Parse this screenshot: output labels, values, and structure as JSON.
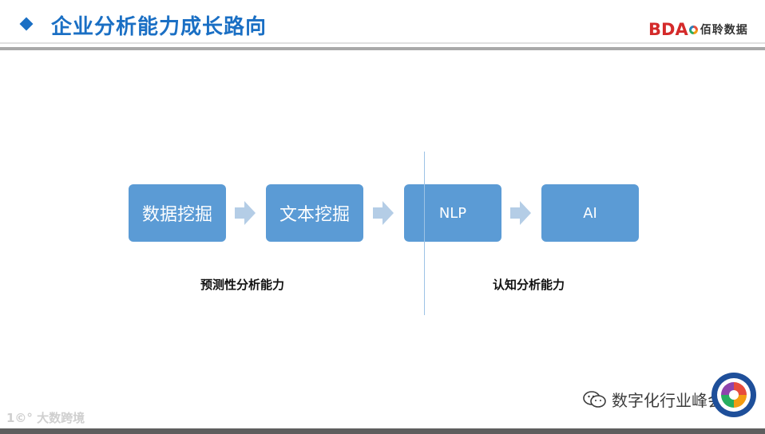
{
  "header": {
    "title": "企业分析能力成长路向",
    "logo_text": "BDA",
    "logo_cn": "佰聆数据"
  },
  "flow": {
    "steps": [
      {
        "label": "数据挖掘"
      },
      {
        "label": "文本挖掘"
      },
      {
        "label": "NLP"
      },
      {
        "label": "AI"
      }
    ],
    "captions": [
      "预测性分析能力",
      "认知分析能力"
    ]
  },
  "footer": {
    "watermark_left": "1©° 大数跨境",
    "wechat_account": "数字化行业峰会"
  },
  "colors": {
    "accent": "#1a6fc4",
    "step_fill": "#5b9bd5",
    "arrow_fill": "#b4cde6",
    "divider": "#9dc3e6",
    "logo_red": "#d42a2a"
  },
  "icons": [
    "diamond-bullet-icon",
    "arrow-right-icon",
    "wechat-icon",
    "seal-icon"
  ]
}
